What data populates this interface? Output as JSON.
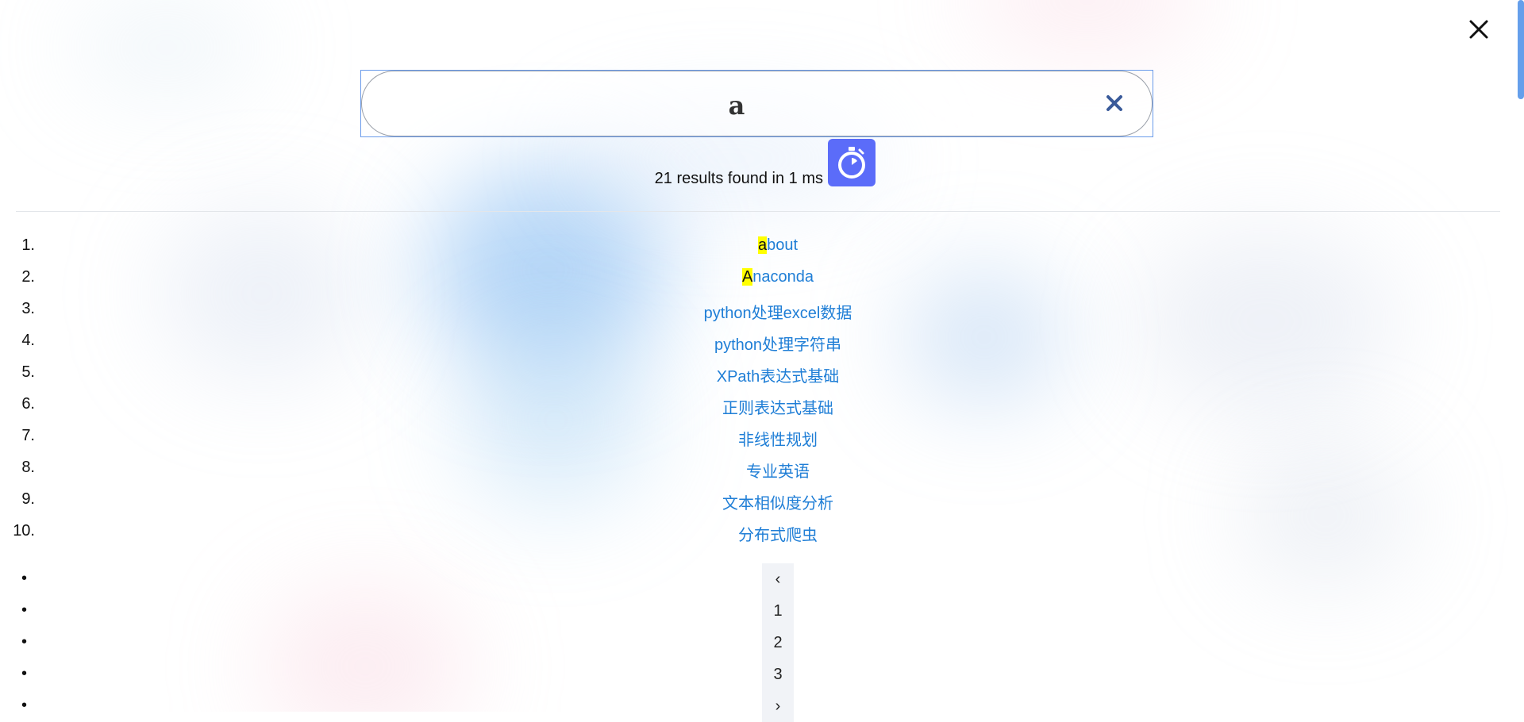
{
  "search": {
    "query": "a",
    "clear_icon": "close-x-icon"
  },
  "close_icon": "close-x-icon",
  "timer_icon": "stopwatch-icon",
  "stats": {
    "result_count_text": "21 results found in 1 ms"
  },
  "results": [
    {
      "num": "1.",
      "highlight": "a",
      "rest": "bout"
    },
    {
      "num": "2.",
      "highlight": "A",
      "rest": "naconda"
    },
    {
      "num": "3.",
      "highlight": "",
      "rest": "python处理excel数据"
    },
    {
      "num": "4.",
      "highlight": "",
      "rest": "python处理字符串"
    },
    {
      "num": "5.",
      "highlight": "",
      "rest": "XPath表达式基础"
    },
    {
      "num": "6.",
      "highlight": "",
      "rest": "正则表达式基础"
    },
    {
      "num": "7.",
      "highlight": "",
      "rest": "非线性规划"
    },
    {
      "num": "8.",
      "highlight": "",
      "rest": "专业英语"
    },
    {
      "num": "9.",
      "highlight": "",
      "rest": "文本相似度分析"
    },
    {
      "num": "10.",
      "highlight": "",
      "rest": "分布式爬虫"
    }
  ],
  "pagination": {
    "bullet": "•",
    "prev": "‹",
    "pages": [
      "1",
      "2",
      "3"
    ],
    "next": "›"
  },
  "colors": {
    "link": "#1f7ed6",
    "highlight": "#ffff00",
    "timer_badge": "#5b6cf9",
    "search_border": "#6a9bea",
    "scrollbar": "#4a8ee8"
  }
}
